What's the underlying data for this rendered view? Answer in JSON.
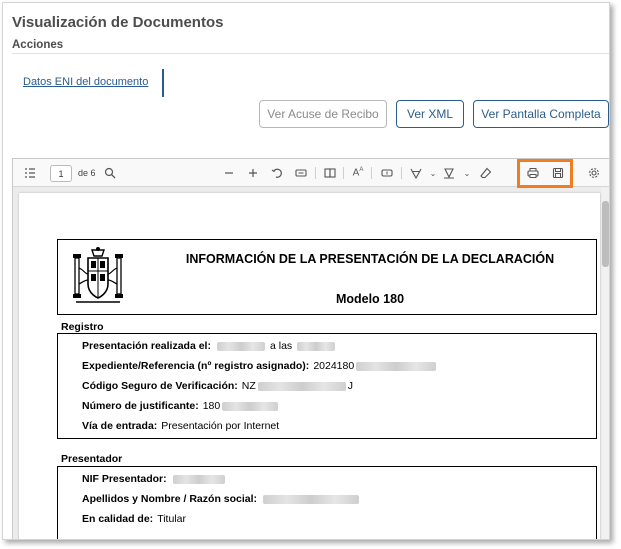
{
  "header": {
    "title": "Visualización de Documentos",
    "section": "Acciones"
  },
  "tabs": [
    {
      "label": "Datos ENI del documento"
    }
  ],
  "actions": {
    "acuse": "Ver Acuse de Recibo",
    "xml": "Ver XML",
    "fullscreen": "Ver Pantalla Completa"
  },
  "viewer": {
    "page_current": "1",
    "page_total_label": "de 6",
    "icons": [
      "sidebar-toggle-icon",
      "search-icon",
      "zoom-out-icon",
      "zoom-in-icon",
      "rotate-icon",
      "fit-width-icon",
      "two-page-icon",
      "text-tool-icon",
      "comment-icon",
      "draw-icon",
      "highlight-icon",
      "eraser-icon",
      "print-icon",
      "save-icon",
      "settings-icon"
    ],
    "highlight_color": "#ef7d22"
  },
  "document": {
    "title": "INFORMACIÓN DE LA PRESENTACIÓN DE LA DECLARACIÓN",
    "subtitle": "Modelo 180",
    "registro": {
      "heading": "Registro",
      "presentacion_label": "Presentación realizada el:",
      "presentacion_mid": "a las",
      "expediente_label": "Expediente/Referencia (nº registro asignado):",
      "expediente_value": "2024180",
      "csv_label": "Código Seguro de Verificación:",
      "csv_prefix": "NZ",
      "csv_suffix": "J",
      "justificante_label": "Número de justificante:",
      "justificante_value": "180",
      "via_label": "Vía de entrada:",
      "via_value": "Presentación por Internet"
    },
    "presentador": {
      "heading": "Presentador",
      "nif_label": "NIF Presentador:",
      "nombre_label": "Apellidos y Nombre / Razón social:",
      "calidad_label": "En calidad de:",
      "calidad_value": "Titular"
    }
  }
}
